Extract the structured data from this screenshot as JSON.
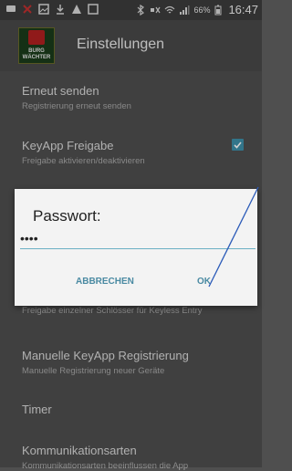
{
  "status_bar": {
    "battery_percent": "66%",
    "time": "16:47",
    "icons": [
      "message-icon",
      "close-icon",
      "image-icon",
      "download-icon",
      "warning-icon",
      "image-icon",
      "bluetooth-icon",
      "mute-icon",
      "wifi-icon",
      "signal-icon",
      "battery-icon"
    ]
  },
  "app_bar": {
    "title": "Einstellungen",
    "logo_text": "BURG WÄCHTER"
  },
  "settings": [
    {
      "title": "Erneut senden",
      "subtitle": "Registrierung erneut senden"
    },
    {
      "title": "KeyApp Freigabe",
      "subtitle": "Freigabe aktivieren/deaktivieren",
      "checked": true
    },
    {
      "title": "",
      "subtitle": "Freigabe einzelner Schlösser für Keyless Entry"
    },
    {
      "title": "Manuelle KeyApp Registrierung",
      "subtitle": "Manuelle Registrierung neuer Geräte"
    },
    {
      "title": "Timer",
      "subtitle": ""
    },
    {
      "title": "Kommunikationsarten",
      "subtitle": "Kommunikationsarten beeinflussen die App"
    }
  ],
  "dialog": {
    "title": "Passwort:",
    "password_value": "••••",
    "cancel_label": "ABBRECHEN",
    "ok_label": "OK"
  },
  "colors": {
    "accent": "#3d8fa9",
    "annotation_line": "#2a5ab8"
  }
}
